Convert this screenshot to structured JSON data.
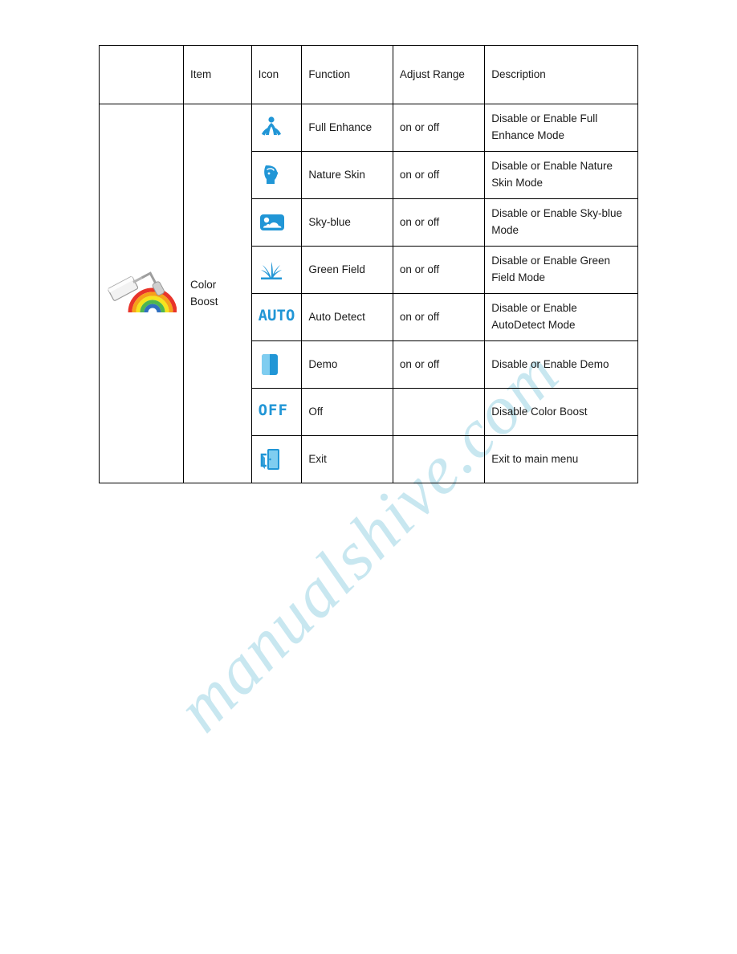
{
  "watermark": {
    "text": "manualshive.com"
  },
  "table": {
    "headers": [
      "",
      "Item",
      "Icon",
      "Function",
      "Adjust Range",
      "Description"
    ],
    "group": {
      "item_label_line1": "Color",
      "item_label_line2": "Boost",
      "icon_name": "paint-roller-rainbow-icon"
    },
    "rows": [
      {
        "icon": "full-enhance-icon",
        "function": "Full Enhance",
        "adjust_range": "on or off",
        "description_line1": "Disable or Enable Full",
        "description_line2": "Enhance Mode"
      },
      {
        "icon": "nature-skin-icon",
        "function": "Nature Skin",
        "adjust_range": "on or off",
        "description_line1": "Disable or Enable Nature",
        "description_line2": "Skin Mode"
      },
      {
        "icon": "sky-blue-icon",
        "function": "Sky-blue",
        "adjust_range": "on or off",
        "description_line1": "Disable or Enable Sky-blue",
        "description_line2": "Mode"
      },
      {
        "icon": "green-field-icon",
        "function": "Green Field",
        "adjust_range": "on or off",
        "description_line1": "Disable or Enable Green",
        "description_line2": "Field Mode"
      },
      {
        "icon": "auto-detect-icon",
        "icon_text": "AUTO",
        "function": "Auto Detect",
        "adjust_range": "on or off",
        "description_line1": "Disable or Enable",
        "description_line2": "AutoDetect Mode"
      },
      {
        "icon": "demo-icon",
        "function": "Demo",
        "adjust_range": "on or off",
        "description_line1": "Disable or Enable Demo",
        "description_line2": ""
      },
      {
        "icon": "off-icon",
        "icon_text": "OFF",
        "function": "Off",
        "adjust_range": "",
        "description_line1": "Disable Color Boost",
        "description_line2": ""
      },
      {
        "icon": "exit-icon",
        "function": "Exit",
        "adjust_range": "",
        "description_line1": "Exit to main menu",
        "description_line2": ""
      }
    ]
  },
  "colors": {
    "icon_blue": "#2196d6",
    "icon_blue_dark": "#1278b5",
    "watermark": "#bfe3ee",
    "border": "#000000"
  }
}
